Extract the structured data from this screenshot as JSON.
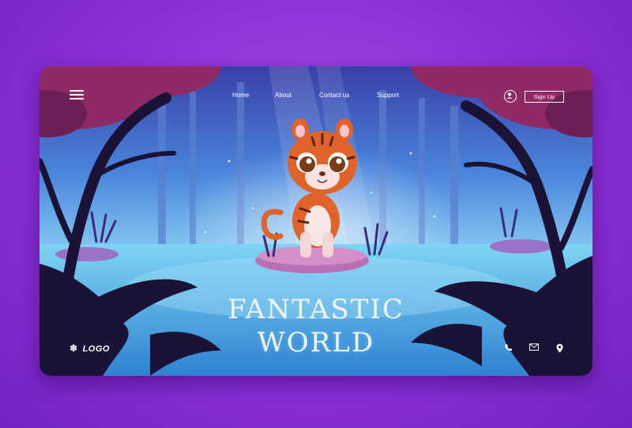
{
  "nav": {
    "menu_icon": "hamburger-icon",
    "links": [
      "Home",
      "About",
      "Contact us",
      "Support"
    ],
    "user_icon": "user-icon",
    "signup_label": "Sign Up"
  },
  "hero": {
    "title_line1": "FANTASTIC",
    "title_line2": "WORLD"
  },
  "footer": {
    "logo_text": "LOGO",
    "logo_icon": "snowflake-icon",
    "icons": [
      "phone-icon",
      "mail-icon",
      "location-pin-icon"
    ]
  },
  "colors": {
    "background": "#8a2fd6",
    "card_sky": "#3b7ad6",
    "water": "#5ab6ea",
    "foliage_red": "#8f2a64",
    "silhouette": "#1a1336",
    "tiger": "#e0632a"
  }
}
